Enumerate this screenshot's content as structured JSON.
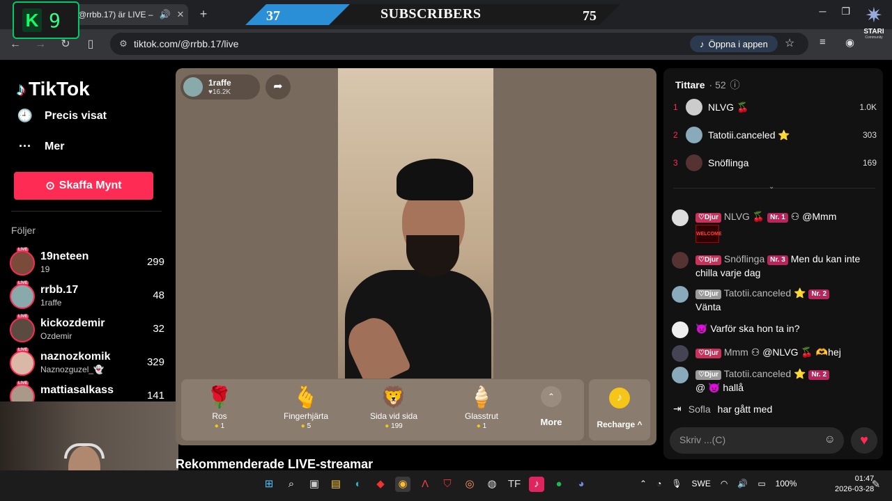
{
  "browser": {
    "tab_title": "@rrbb.17) är LIVE –",
    "url": "tiktok.com/@rrbb.17/live",
    "open_app": "Öppna i appen"
  },
  "overlay": {
    "k_letter": "K",
    "k_number": "9",
    "subs_left": "37",
    "subs_label": "SUBSCRIBERS",
    "subs_right": "75",
    "stari_word": "STARI",
    "stari_sub": "Community"
  },
  "sidebar": {
    "logo": "TikTok",
    "nav": [
      {
        "label": "Precis visat",
        "icon": "history-icon"
      },
      {
        "label": "Mer",
        "icon": "more-dots-icon"
      }
    ],
    "coins_button": "Skaffa Mynt",
    "follows_heading": "Följer",
    "live_tag": "LIVE",
    "following": [
      {
        "name": "19neteen",
        "sub": "19",
        "count": "299"
      },
      {
        "name": "rrbb.17",
        "sub": "1raffe",
        "count": "48"
      },
      {
        "name": "kickozdemir",
        "sub": "Ozdemir",
        "count": "32"
      },
      {
        "name": "naznozkomik",
        "sub": "Naznozguzel_👻",
        "count": "329"
      },
      {
        "name": "mattiasalkass",
        "sub": "",
        "count": "141"
      }
    ]
  },
  "stream": {
    "host_name": "1raffe",
    "host_likes": "♥16.2K",
    "gifts": [
      {
        "emoji": "🌹",
        "name": "Ros",
        "price": "1"
      },
      {
        "emoji": "🫰",
        "name": "Fingerhjärta",
        "price": "5"
      },
      {
        "emoji": "🦁",
        "name": "Sida vid sida",
        "price": "199"
      },
      {
        "emoji": "🍦",
        "name": "Glasstrut",
        "price": "1"
      }
    ],
    "more_label": "More",
    "recharge_label": "Recharge ^",
    "recommended": "Rekommenderade LIVE-streamar"
  },
  "panel": {
    "viewers_title": "Tittare",
    "viewers_count": "· 52",
    "top": [
      {
        "rank": "1",
        "name": "NLVG 🍒",
        "count": "1.0K"
      },
      {
        "rank": "2",
        "name": "Tatotii.canceled ⭐",
        "count": "303"
      },
      {
        "rank": "3",
        "name": "Snöflinga",
        "count": "169"
      }
    ],
    "messages": [
      {
        "badge": "♡Djur",
        "user": "NLVG 🍒",
        "nr": "Nr. 1",
        "text": "@Mmm",
        "extra": "WELCOME"
      },
      {
        "badge": "♡Djur",
        "user": "Snöflinga",
        "nr": "Nr. 3",
        "text": "Men du kan inte chilla varje dag"
      },
      {
        "badge": "♡Djur",
        "user": "Tatotii.canceled ⭐",
        "nr": "Nr. 2",
        "text": "Vänta"
      },
      {
        "badge": "",
        "user": "👿",
        "nr": "",
        "text": "Varför ska hon ta in?"
      },
      {
        "badge": "♡Djur",
        "user": "Mmm",
        "nr": "",
        "text": "@NLVG 🍒 🫶hej"
      },
      {
        "badge": "♡Djur",
        "user": "Tatotii.canceled ⭐",
        "nr": "Nr. 2",
        "text": "@ 👿 hallå"
      }
    ],
    "joined_user": "Sofla",
    "joined_text": "har gått med",
    "chat_placeholder": "Skriv ...(C)"
  },
  "taskbar": {
    "lang": "SWE",
    "battery": "100%",
    "time": "01:47",
    "date": "2026-03-28"
  }
}
